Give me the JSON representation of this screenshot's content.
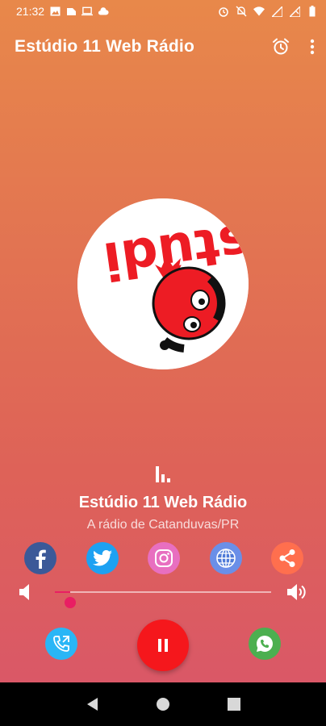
{
  "status_bar": {
    "time": "21:32"
  },
  "app_bar": {
    "title": "Estúdio 11 Web Rádio",
    "icons": [
      "alarm-icon",
      "more-vert-icon"
    ]
  },
  "logo": {
    "text": "stúdi",
    "colors": {
      "red": "#ed1c24",
      "white": "#ffffff",
      "black": "#111111"
    }
  },
  "player": {
    "station_name": "Estúdio 11 Web Rádio",
    "subtitle": "A rádio de Catanduvas/PR",
    "volume_fraction": 0.07,
    "state": "playing"
  },
  "social": [
    {
      "name": "facebook",
      "icon": "facebook-icon",
      "color": "#3b5998"
    },
    {
      "name": "twitter",
      "icon": "twitter-icon",
      "color": "#1da1f2"
    },
    {
      "name": "instagram",
      "icon": "instagram-icon",
      "color": "#e86fc0"
    },
    {
      "name": "website",
      "icon": "globe-icon",
      "color": "#6a8fe8"
    },
    {
      "name": "share",
      "icon": "share-icon",
      "color": "#ff6f4e"
    }
  ],
  "colors": {
    "accent": "#e91e63",
    "play": "#f5171c",
    "call": "#29b6f6",
    "whatsapp": "#4caf50"
  }
}
